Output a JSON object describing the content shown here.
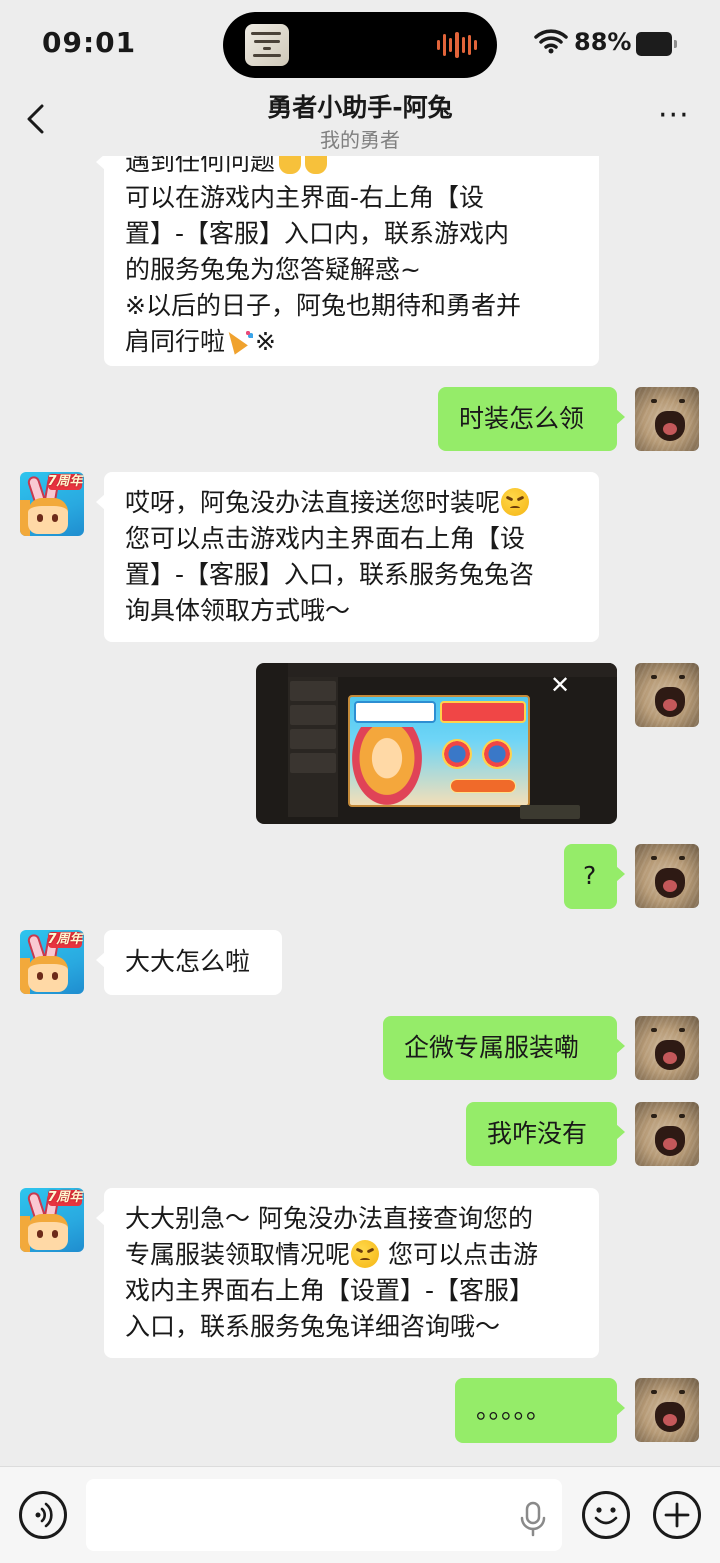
{
  "status_bar": {
    "time": "09:01",
    "battery": "88%"
  },
  "header": {
    "title": "勇者小助手-阿兔",
    "subtitle": "我的勇者",
    "more_label": "···"
  },
  "messages": [
    {
      "side": "left",
      "lines": [
        "遇到任何问题",
        "可以在游戏内主界面-右上角【设",
        "置】-【客服】入口内，联系游戏内",
        "的服务兔兔为您答疑解惑~",
        "※以后的日子，阿兔也期待和勇者并",
        "肩同行啦",
        "※"
      ]
    },
    {
      "side": "right",
      "lines": [
        "时装怎么领"
      ]
    },
    {
      "side": "left",
      "lines": [
        "哎呀，阿兔没办法直接送您时装呢",
        "您可以点击游戏内主界面右上角【设",
        "置】-【客服】入口，联系服务兔兔咨",
        "询具体领取方式哦～"
      ]
    },
    {
      "side": "right",
      "type": "image",
      "icon": "game-screenshot"
    },
    {
      "side": "right",
      "lines": [
        "?"
      ]
    },
    {
      "side": "left",
      "lines": [
        "大大怎么啦"
      ]
    },
    {
      "side": "right",
      "lines": [
        "企微专属服装嘞"
      ]
    },
    {
      "side": "right",
      "lines": [
        "我咋没有"
      ]
    },
    {
      "side": "left",
      "lines": [
        "大大别急～ 阿兔没办法直接查询您的",
        "专属服装领取情况呢",
        " 您可以点击游",
        "戏内主界面右上角【设置】-【客服】",
        "入口，联系服务兔兔详细咨询哦～"
      ]
    },
    {
      "side": "right",
      "lines": [
        "。。。。。"
      ]
    }
  ],
  "bot_avatar": {
    "badge": "7周年"
  },
  "input_bar": {
    "placeholder": ""
  },
  "colors": {
    "right_bubble": "#95ec69",
    "left_bubble": "#ffffff",
    "background": "#ededed"
  }
}
